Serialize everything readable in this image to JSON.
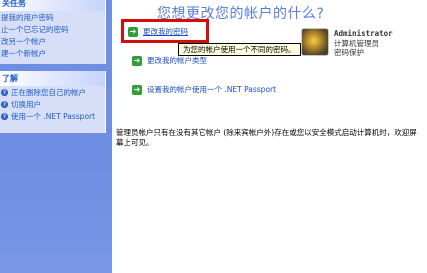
{
  "sidebar": {
    "tasks_panel": {
      "header": "关任务",
      "items": [
        {
          "label": "提我的用户密码"
        },
        {
          "label": "止一个已忘记的密码"
        },
        {
          "label": "改另一个帐户"
        },
        {
          "label": "建一个新帐户"
        }
      ]
    },
    "learn_panel": {
      "header": "了解",
      "items": [
        {
          "label": "正在删除您自己的帐户"
        },
        {
          "label": "切换用户"
        },
        {
          "label": "使用一个 .NET Passport"
        }
      ]
    }
  },
  "main": {
    "title": "您想更改您的帐户的什么?",
    "tasks": [
      {
        "label": "更改我的密码"
      },
      {
        "label": "更改我的帐户类型"
      },
      {
        "label": "设置我的帐户使用一个 .NET Passport"
      }
    ],
    "tooltip": "为您的帐户使用一个不同的密码。",
    "user": {
      "name": "Administrator",
      "role": "计算机管理员",
      "password_state": "密码保护"
    },
    "note": "管理员帐户只有在没有其它帐户 (除来宾帐户外)存在或您以安全模式启动计算机时，欢迎屏幕上可见。"
  },
  "colors": {
    "sidebar_bg": "#6f8fe3",
    "link": "#1a4ec6",
    "title": "#5a7edc",
    "highlight": "#d40d0d",
    "arrow": "#2f9d3a"
  }
}
